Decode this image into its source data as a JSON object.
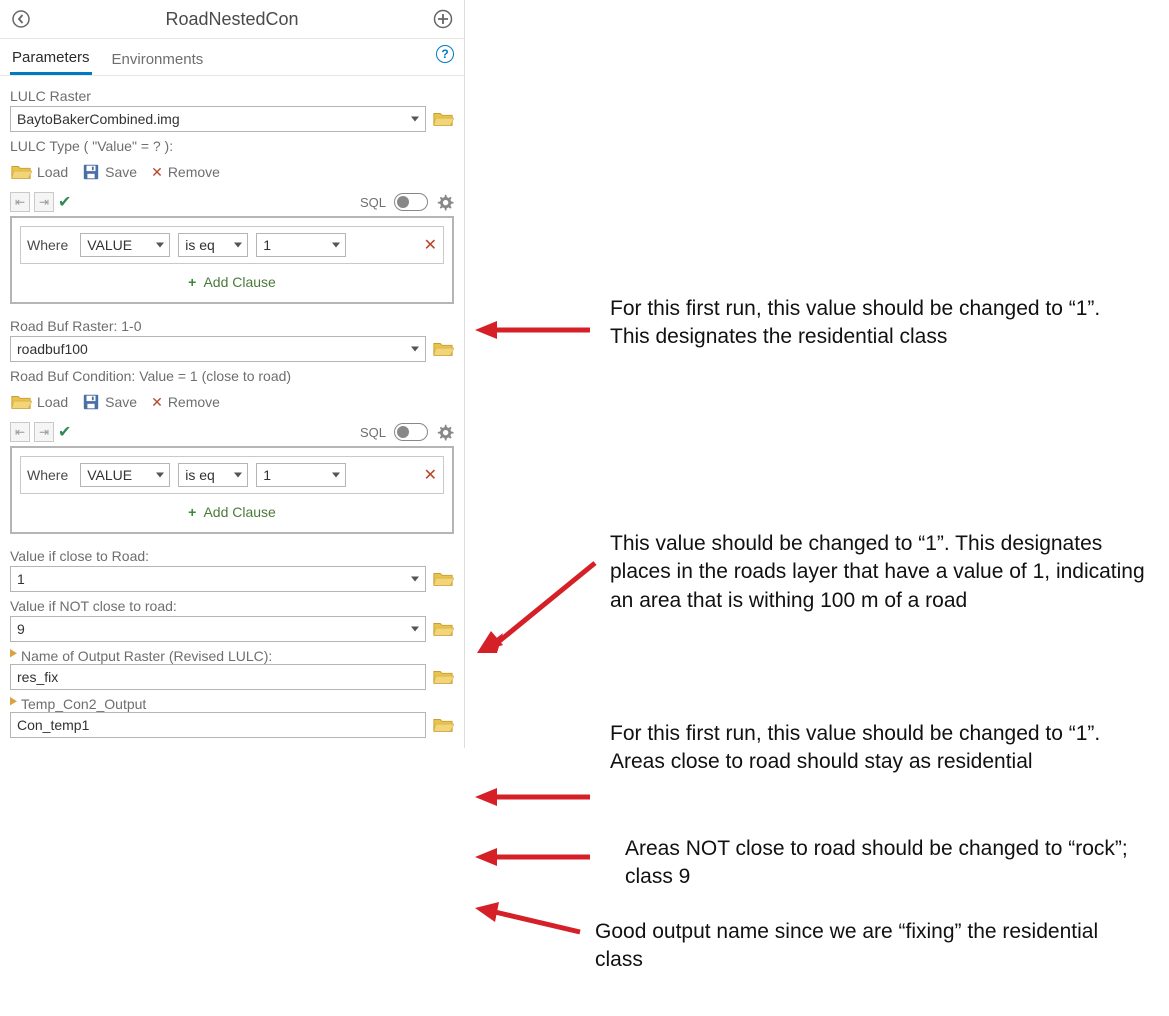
{
  "title": "RoadNestedCon",
  "tabs": {
    "parameters": "Parameters",
    "environments": "Environments"
  },
  "lulc": {
    "label": "LULC Raster",
    "value": "BaytoBakerCombined.img",
    "type_label": "LULC Type  ( \"Value\" = ? ):"
  },
  "toolbar": {
    "load": "Load",
    "save": "Save",
    "remove": "Remove"
  },
  "sql_label": "SQL",
  "clause1": {
    "where": "Where",
    "field": "VALUE",
    "op": "is eq",
    "value": "1",
    "add": "Add Clause"
  },
  "roadbuf": {
    "label": "Road Buf Raster: 1-0",
    "value": "roadbuf100",
    "cond_label": "Road Buf Condition: Value = 1 (close to road)"
  },
  "clause2": {
    "where": "Where",
    "field": "VALUE",
    "op": "is eq",
    "value": "1",
    "add": "Add Clause"
  },
  "val_close": {
    "label": "Value if close to Road:",
    "value": "1"
  },
  "val_notclose": {
    "label": "Value if NOT close to road:",
    "value": "9"
  },
  "output_name": {
    "label": "Name of Output Raster (Revised LULC):",
    "value": "res_fix"
  },
  "temp_out": {
    "label": "Temp_Con2_Output",
    "value": "Con_temp1"
  },
  "annotations": {
    "a1": "For this first run, this value should be changed to “1”. This designates the residential class",
    "a2": "This value should be changed to “1”. This designates places in the roads layer that have a value of 1, indicating an area that is withing 100 m of a road",
    "a3": "For this first run, this value should be changed to “1”. Areas close to road should stay as residential",
    "a4": "Areas NOT close to road should be changed to “rock”; class 9",
    "a5": "Good output name since we are “fixing” the residential class"
  }
}
